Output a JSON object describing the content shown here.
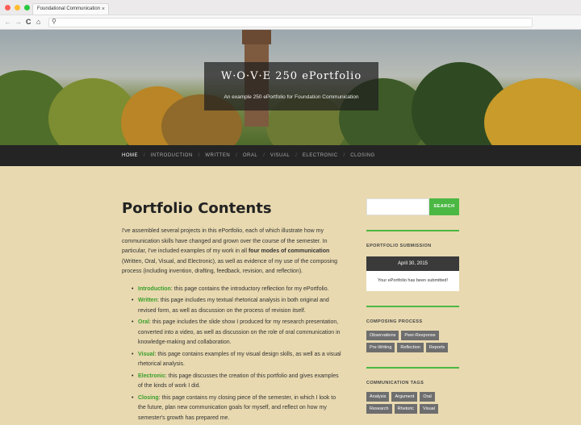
{
  "browser": {
    "tab_title": "Foundational Communication",
    "tab_close": "×",
    "back": "←",
    "forward": "→",
    "reload": "C",
    "home": "⌂",
    "search_glyph": "⚲",
    "colors": {
      "close": "#ff5f57",
      "minimize": "#febc2e",
      "maximize": "#28c840"
    }
  },
  "header": {
    "title": "W·O·V·E 250 ePortfolio",
    "subtitle": "An example 250 ePortfolio for Foundation Communication"
  },
  "nav": {
    "items": [
      "HOME",
      "INTRODUCTION",
      "WRITTEN",
      "ORAL",
      "VISUAL",
      "ELECTRONIC",
      "CLOSING"
    ],
    "separator": "/",
    "active": "HOME"
  },
  "main": {
    "title": "Portfolio Contents",
    "intro_a": "I've assembled several projects in this ePortfolio, each of which illustrate how my communication skills have changed and grown over the course of the semester. In particular, I've included examples of my work in all ",
    "intro_bold": "four modes of communication",
    "intro_b": " (Written, Oral, Visual, and Electronic), as well as evidence of my use of the composing process (including invention, drafting, feedback, revision, and reflection).",
    "items": [
      {
        "link": "Introduction",
        "text": ": this page contains the introductory reflection for my ePortfolio."
      },
      {
        "link": "Written",
        "text": ": this page includes my textual rhetorical analysis in both original and revised form, as well as discussion on the process of revision itself."
      },
      {
        "link": "Oral",
        "text": ": this page includes the slide show I produced for my research presentation, converted into a video, as well as discussion on the role of oral communication in knowledge-making and collaboration."
      },
      {
        "link": "Visual",
        "text": ": this page contains examples of my visual design skills, as well as a visual rhetorical analysis."
      },
      {
        "link": "Electronic",
        "text": ": this page discusses the creation of this portfolio and gives examples of the kinds of work I did."
      },
      {
        "link": "Closing",
        "text": ": this page contains my closing piece of the semester, in which I look to the future, plan new communication goals for myself, and reflect on how my semester's growth has prepared me."
      }
    ]
  },
  "sidebar": {
    "search_button": "SEARCH",
    "submission": {
      "title": "EPORTFOLIO SUBMISSION",
      "date": "April 30, 2015",
      "message": "Your ePortfolio has been submitted!"
    },
    "process": {
      "title": "COMPOSING PROCESS",
      "tags": [
        "Observations",
        "Peer-Response",
        "Pre-Writing",
        "Reflection",
        "Reports"
      ]
    },
    "comm_tags": {
      "title": "COMMUNICATION TAGS",
      "tags": [
        "Analysis",
        "Argument",
        "Oral",
        "Research",
        "Rhetoric",
        "Visual"
      ]
    },
    "accent": "#4bb843"
  }
}
